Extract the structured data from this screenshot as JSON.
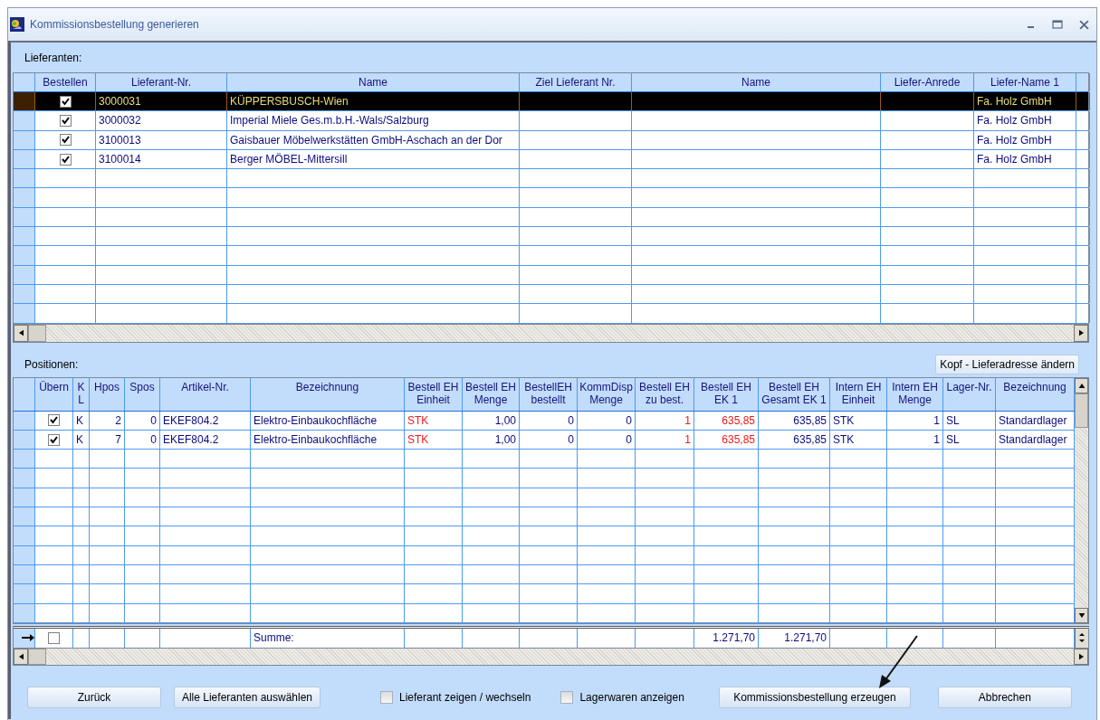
{
  "window": {
    "title": "Kommissionsbestellung generieren"
  },
  "suppliers": {
    "label": "Lieferanten:",
    "columns": [
      "Bestellen",
      "Lieferant-Nr.",
      "Name",
      "Ziel Lieferant Nr.",
      "Name",
      "Liefer-Anrede",
      "Liefer-Name 1"
    ],
    "rows": [
      {
        "selected": true,
        "cells": [
          {
            "checked": true
          },
          "3000031",
          "KÜPPERSBUSCH-Wien",
          null,
          null,
          null,
          "Fa. Holz GmbH"
        ]
      },
      {
        "selected": false,
        "cells": [
          {
            "checked": true
          },
          "3000032",
          "Imperial Miele Ges.m.b.H.-Wals/Salzburg",
          null,
          null,
          null,
          "Fa. Holz GmbH"
        ]
      },
      {
        "selected": false,
        "cells": [
          {
            "checked": true
          },
          "3100013",
          "Gaisbauer Möbelwerkstätten GmbH-Aschach an der Dor",
          null,
          null,
          null,
          "Fa. Holz GmbH"
        ]
      },
      {
        "selected": false,
        "cells": [
          {
            "checked": true
          },
          "3100014",
          "Berger MÖBEL-Mittersill",
          null,
          null,
          null,
          "Fa. Holz GmbH"
        ]
      }
    ]
  },
  "positions": {
    "label": "Positionen:",
    "button": "Kopf - Lieferadresse ändern",
    "columns": [
      {
        "lines": [
          "Übern"
        ]
      },
      {
        "lines": [
          "K",
          "L"
        ]
      },
      {
        "lines": [
          "Hpos"
        ]
      },
      {
        "lines": [
          "Spos"
        ]
      },
      {
        "lines": [
          "Artikel-Nr."
        ]
      },
      {
        "lines": [
          "Bezeichnung"
        ]
      },
      {
        "lines": [
          "Bestell EH",
          "Einheit"
        ],
        "alert": true
      },
      {
        "lines": [
          "Bestell EH",
          "Menge"
        ]
      },
      {
        "lines": [
          "BestellEH",
          "bestellt"
        ]
      },
      {
        "lines": [
          "KommDisp",
          "Menge"
        ]
      },
      {
        "lines": [
          "Bestell EH",
          "zu best."
        ],
        "alert": true
      },
      {
        "lines": [
          "Bestell EH",
          "EK 1"
        ],
        "alert": true
      },
      {
        "lines": [
          "Bestell EH",
          "Gesamt EK 1"
        ]
      },
      {
        "lines": [
          "Intern EH",
          "Einheit"
        ]
      },
      {
        "lines": [
          "Intern EH",
          "Menge"
        ]
      },
      {
        "lines": [
          "Lager-Nr."
        ]
      },
      {
        "lines": [
          "Bezeichnung"
        ]
      }
    ],
    "rows": [
      {
        "cells": [
          {
            "checked": true
          },
          "K",
          "2",
          "0",
          "EKEF804.2",
          "Elektro-Einbaukochfläche",
          "STK",
          "1,00",
          "0",
          "0",
          "1",
          "635,85",
          "635,85",
          "STK",
          "1",
          "SL",
          "Standardlager"
        ]
      },
      {
        "cells": [
          {
            "checked": true
          },
          "K",
          "7",
          "0",
          "EKEF804.2",
          "Elektro-Einbaukochfläche",
          "STK",
          "1,00",
          "0",
          "0",
          "1",
          "635,85",
          "635,85",
          "STK",
          "1",
          "SL",
          "Standardlager"
        ]
      }
    ],
    "summary": {
      "cells": [
        {
          "checked": false
        },
        null,
        null,
        null,
        null,
        "Summe:",
        null,
        null,
        null,
        null,
        null,
        "1.271,70",
        "1.271,70",
        null,
        null,
        null,
        null
      ]
    }
  },
  "footer": [
    {
      "kind": "button",
      "label": "Zurück"
    },
    {
      "kind": "button",
      "label": "Alle Lieferanten auswählen"
    },
    {
      "kind": "checkbox",
      "label": "Lieferant zeigen / wechseln",
      "checked": false
    },
    {
      "kind": "checkbox",
      "label": "Lagerwaren anzeigen",
      "checked": false
    },
    {
      "kind": "button",
      "label": "Kommissionsbestellung erzeugen"
    },
    {
      "kind": "button",
      "label": "Abbrechen"
    }
  ]
}
